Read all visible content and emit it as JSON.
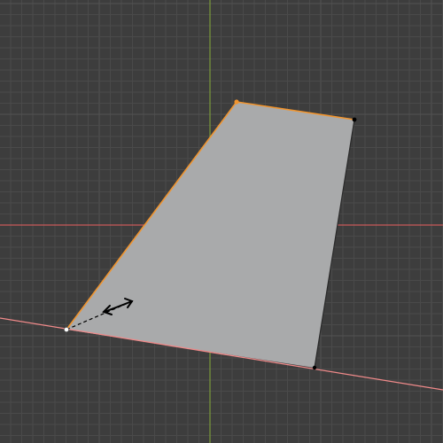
{
  "viewport": {
    "background": "#3d3d3d",
    "grid_minor_color": "#4a4a4a",
    "grid_major_color": "#525252",
    "axis_x_color": "#c85a5a",
    "axis_y_color": "#7a9a3a"
  },
  "mesh": {
    "face_color": "#a9aaab",
    "selected_edge_color": "#f0942e",
    "selected_vertex_color": "#f0942e",
    "unselected_vertex_color": "#000000",
    "active_vertex_color": "#ffffff",
    "slide_guide_color": "#f08a8a"
  },
  "tool": {
    "name": "edge-slide",
    "cursor_icon": "double-arrow-icon",
    "guide_line_color": "#000000"
  }
}
